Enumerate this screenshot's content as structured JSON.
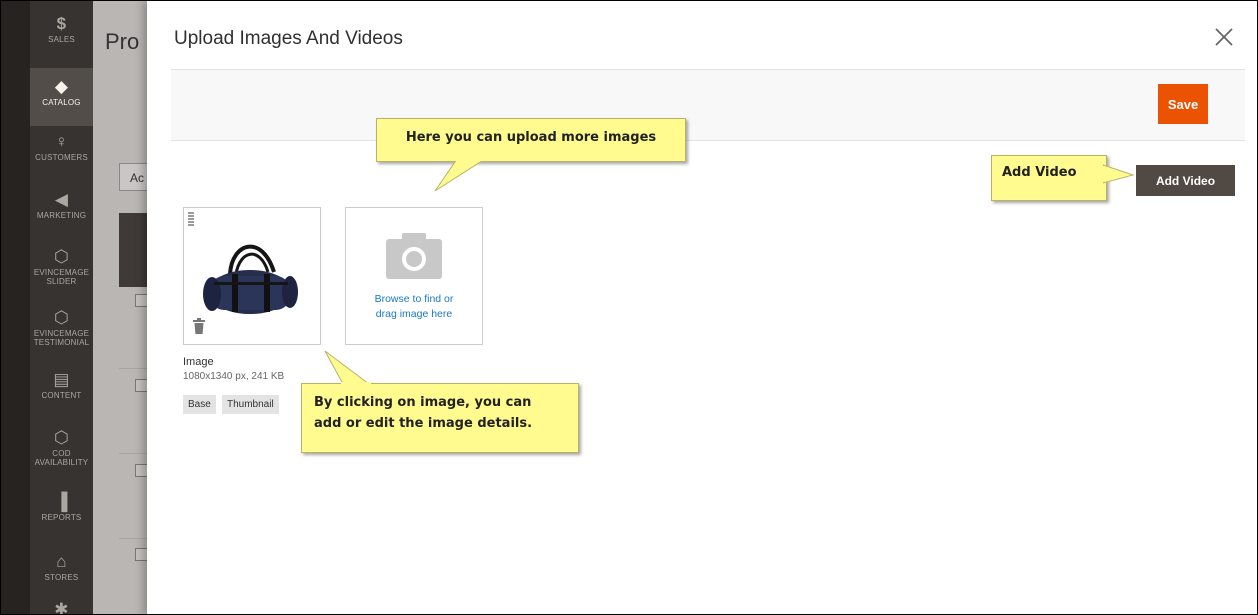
{
  "sidebar": {
    "items": [
      {
        "label": "SALES",
        "icon": "dollar-icon"
      },
      {
        "label": "CATALOG",
        "icon": "cube-icon"
      },
      {
        "label": "CUSTOMERS",
        "icon": "person-icon"
      },
      {
        "label": "MARKETING",
        "icon": "megaphone-icon"
      },
      {
        "label": "EVINCEMAGE SLIDER",
        "icon": "hexagon-icon"
      },
      {
        "label": "EVINCEMAGE TESTIMONIAL",
        "icon": "hexagon-icon"
      },
      {
        "label": "CONTENT",
        "icon": "layout-icon"
      },
      {
        "label": "COD AVAILABILITY",
        "icon": "hexagon-icon"
      },
      {
        "label": "REPORTS",
        "icon": "bar-chart-icon"
      },
      {
        "label": "STORES",
        "icon": "store-icon"
      }
    ],
    "active": "CATALOG"
  },
  "background": {
    "page_title": "Pro",
    "select_text": "Ac"
  },
  "modal": {
    "title": "Upload Images And Videos",
    "save_label": "Save",
    "add_video_label": "Add Video",
    "upload_text_line1": "Browse to find or",
    "upload_text_line2": "drag image here",
    "image": {
      "label": "Image",
      "meta": "1080x1340 px, 241 KB",
      "roles": [
        "Base",
        "Thumbnail"
      ]
    }
  },
  "callouts": {
    "upload_more": "Here you can upload more images",
    "add_video": "Add Video",
    "edit_line1": "By clicking on image, you can",
    "edit_line2": "add or edit the image details."
  },
  "colors": {
    "accent": "#eb5202",
    "sidebar": "#373330",
    "link": "#1979c3",
    "callout": "#fffb8f"
  }
}
